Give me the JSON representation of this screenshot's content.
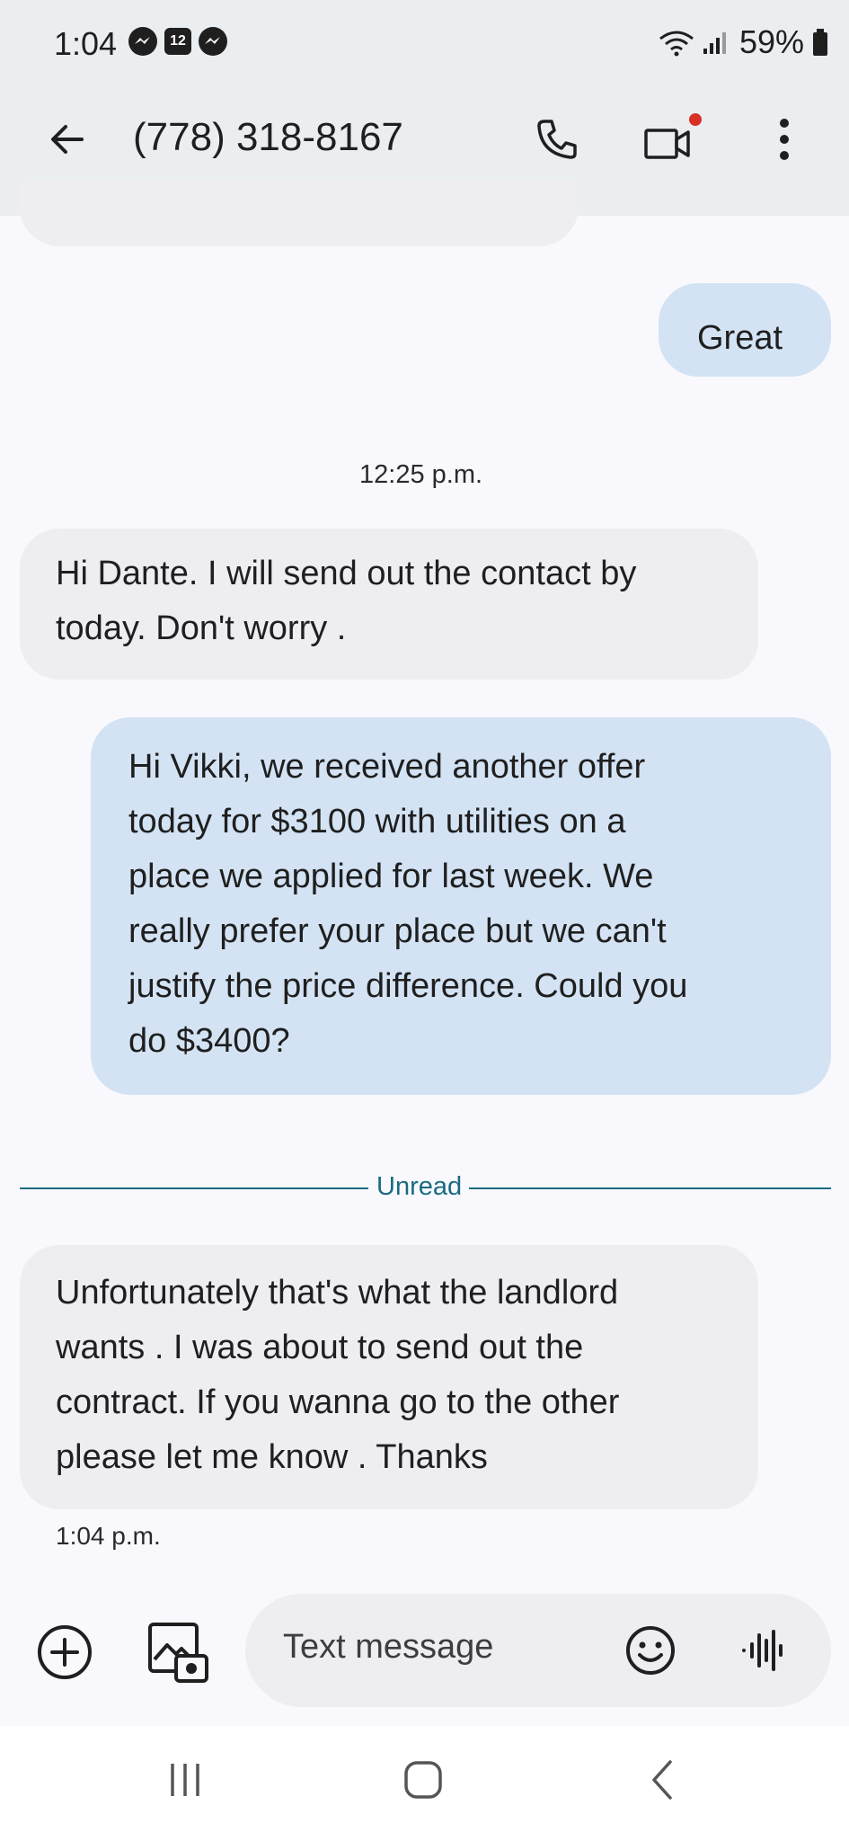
{
  "status_bar": {
    "time": "1:04",
    "calendar_day": "12",
    "battery": "59%"
  },
  "header": {
    "contact": "(778) 318-8167"
  },
  "messages": [
    {
      "direction": "outgoing",
      "lines": [
        "Great"
      ]
    },
    {
      "type": "timestamp",
      "text": "12:25 p.m."
    },
    {
      "direction": "incoming",
      "lines": [
        "Hi Dante. I will send out the contact by",
        "today. Don't worry ."
      ]
    },
    {
      "direction": "outgoing",
      "lines": [
        "Hi Vikki, we received another offer",
        "today for $3100 with utilities on a",
        "place we applied for last week. We",
        "really prefer your place but we can't",
        "justify the price difference. Could you",
        "do $3400?"
      ]
    },
    {
      "type": "divider",
      "text": "Unread"
    },
    {
      "direction": "incoming",
      "lines": [
        "Unfortunately that's what the landlord",
        "wants . I was about to send out the",
        "contract. If you wanna go to the other",
        "please let me know . Thanks"
      ]
    },
    {
      "type": "timestamp",
      "text": "1:04 p.m."
    }
  ],
  "compose": {
    "placeholder": "Text message"
  },
  "colors": {
    "header_bg": "#eaeef1",
    "incoming_bubble": "#eeeef2",
    "outgoing_bubble": "#d3e3f4",
    "unread_divider": "#1a6b80",
    "video_dot": "#d93025"
  }
}
